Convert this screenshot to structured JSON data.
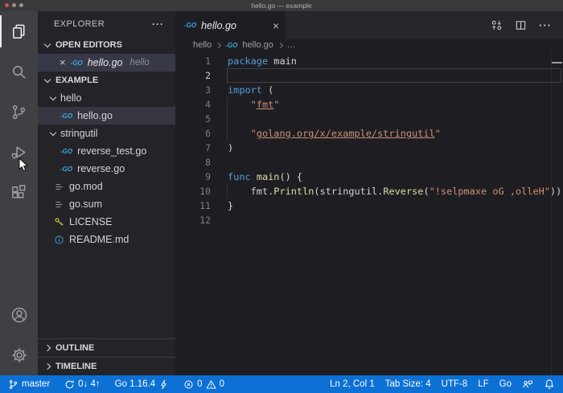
{
  "window": {
    "title": "hello.go — example"
  },
  "colors": {
    "status_bar": "#0c70d4",
    "go_brand": "#3fa6de",
    "keyword": "#569cd6",
    "function": "#dcdcaa",
    "string": "#ce9178"
  },
  "activity_bar": {
    "items": [
      {
        "name": "explorer",
        "icon": "files-icon",
        "active": true
      },
      {
        "name": "search",
        "icon": "search-icon",
        "active": false
      },
      {
        "name": "source-control",
        "icon": "source-control-icon",
        "active": false
      },
      {
        "name": "run-debug",
        "icon": "run-debug-icon",
        "active": false
      },
      {
        "name": "extensions",
        "icon": "extensions-icon",
        "active": false
      }
    ],
    "bottom_items": [
      {
        "name": "account",
        "icon": "account-icon"
      },
      {
        "name": "settings",
        "icon": "gear-icon"
      }
    ]
  },
  "sidebar": {
    "title": "EXPLORER",
    "sections": {
      "open_editors": "OPEN EDITORS",
      "example": "EXAMPLE",
      "outline": "OUTLINE",
      "timeline": "TIMELINE"
    },
    "open_editor": {
      "name": "hello.go",
      "decoration": "hello"
    },
    "tree": [
      {
        "name": "folder-hello",
        "label": "hello",
        "kind": "folder",
        "indent": 16,
        "expanded": true
      },
      {
        "name": "file-hello-go",
        "label": "hello.go",
        "kind": "go",
        "indent": 28,
        "selected": true
      },
      {
        "name": "folder-stringutil",
        "label": "stringutil",
        "kind": "folder",
        "indent": 16,
        "expanded": true
      },
      {
        "name": "file-reverse-test-go",
        "label": "reverse_test.go",
        "kind": "go",
        "indent": 28
      },
      {
        "name": "file-reverse-go",
        "label": "reverse.go",
        "kind": "go",
        "indent": 28
      },
      {
        "name": "file-go-mod",
        "label": "go.mod",
        "kind": "mod",
        "indent": 20
      },
      {
        "name": "file-go-sum",
        "label": "go.sum",
        "kind": "mod",
        "indent": 20
      },
      {
        "name": "file-license",
        "label": "LICENSE",
        "kind": "key",
        "indent": 20
      },
      {
        "name": "file-readme-md",
        "label": "README.md",
        "kind": "info",
        "indent": 20
      }
    ]
  },
  "editor": {
    "tab": {
      "label": "hello.go"
    },
    "actions": [
      {
        "name": "open-changes",
        "icon": "open-changes-icon"
      },
      {
        "name": "split-editor",
        "icon": "split-editor-icon"
      },
      {
        "name": "more-actions",
        "icon": "more-icon"
      }
    ],
    "breadcrumbs": [
      "hello",
      "hello.go",
      "…"
    ],
    "active_line": 2,
    "code": [
      {
        "n": 1,
        "segs": [
          {
            "t": "package",
            "c": "kw"
          },
          {
            "t": " main",
            "c": "pl"
          }
        ]
      },
      {
        "n": 2,
        "segs": []
      },
      {
        "n": 3,
        "segs": [
          {
            "t": "import",
            "c": "kw"
          },
          {
            "t": " (",
            "c": "pl"
          }
        ]
      },
      {
        "n": 4,
        "guide": true,
        "segs": [
          {
            "t": "    ",
            "c": "pl"
          },
          {
            "t": "\"",
            "c": "str"
          },
          {
            "t": "fmt",
            "c": "str ul"
          },
          {
            "t": "\"",
            "c": "str"
          }
        ]
      },
      {
        "n": 5,
        "guide": true,
        "segs": []
      },
      {
        "n": 6,
        "guide": true,
        "segs": [
          {
            "t": "    ",
            "c": "pl"
          },
          {
            "t": "\"",
            "c": "str"
          },
          {
            "t": "golang.org/x/example/stringutil",
            "c": "str ul"
          },
          {
            "t": "\"",
            "c": "str"
          }
        ]
      },
      {
        "n": 7,
        "segs": [
          {
            "t": ")",
            "c": "pl"
          }
        ]
      },
      {
        "n": 8,
        "segs": []
      },
      {
        "n": 9,
        "segs": [
          {
            "t": "func",
            "c": "kw"
          },
          {
            "t": " ",
            "c": "pl"
          },
          {
            "t": "main",
            "c": "fn"
          },
          {
            "t": "() {",
            "c": "pl"
          }
        ]
      },
      {
        "n": 10,
        "guide": true,
        "segs": [
          {
            "t": "    fmt.",
            "c": "pl"
          },
          {
            "t": "Println",
            "c": "fn"
          },
          {
            "t": "(stringutil.",
            "c": "pl"
          },
          {
            "t": "Reverse",
            "c": "fn"
          },
          {
            "t": "(",
            "c": "pl"
          },
          {
            "t": "\"!selpmaxe oG ,olleH\"",
            "c": "str"
          },
          {
            "t": "))",
            "c": "pl"
          }
        ]
      },
      {
        "n": 11,
        "segs": [
          {
            "t": "}",
            "c": "pl"
          }
        ]
      },
      {
        "n": 12,
        "segs": []
      }
    ]
  },
  "status_bar": {
    "left": [
      {
        "name": "branch-indicator",
        "parts": [
          {
            "icon": "branch-icon"
          },
          {
            "text": "master"
          }
        ]
      },
      {
        "name": "sync-changes",
        "parts": [
          {
            "icon": "sync-icon"
          },
          {
            "text": "0↓ 4↑"
          }
        ]
      },
      {
        "name": "go-version",
        "parts": [
          {
            "text": "Go 1.16.4"
          },
          {
            "icon": "bolt-icon"
          }
        ]
      },
      {
        "name": "problems",
        "parts": [
          {
            "icon": "error-circle-icon"
          },
          {
            "text": "0"
          },
          {
            "icon": "warning-triangle-icon"
          },
          {
            "text": "0"
          }
        ]
      }
    ],
    "right": [
      {
        "name": "cursor-position",
        "parts": [
          {
            "text": "Ln 2, Col 1"
          }
        ]
      },
      {
        "name": "tab-size",
        "parts": [
          {
            "text": "Tab Size: 4"
          }
        ]
      },
      {
        "name": "encoding",
        "parts": [
          {
            "text": "UTF-8"
          }
        ]
      },
      {
        "name": "eol",
        "parts": [
          {
            "text": "LF"
          }
        ]
      },
      {
        "name": "language-mode",
        "parts": [
          {
            "text": "Go"
          }
        ]
      },
      {
        "name": "feedback",
        "parts": [
          {
            "icon": "feedback-icon"
          }
        ]
      },
      {
        "name": "notifications",
        "parts": [
          {
            "icon": "bell-icon"
          }
        ]
      }
    ]
  }
}
